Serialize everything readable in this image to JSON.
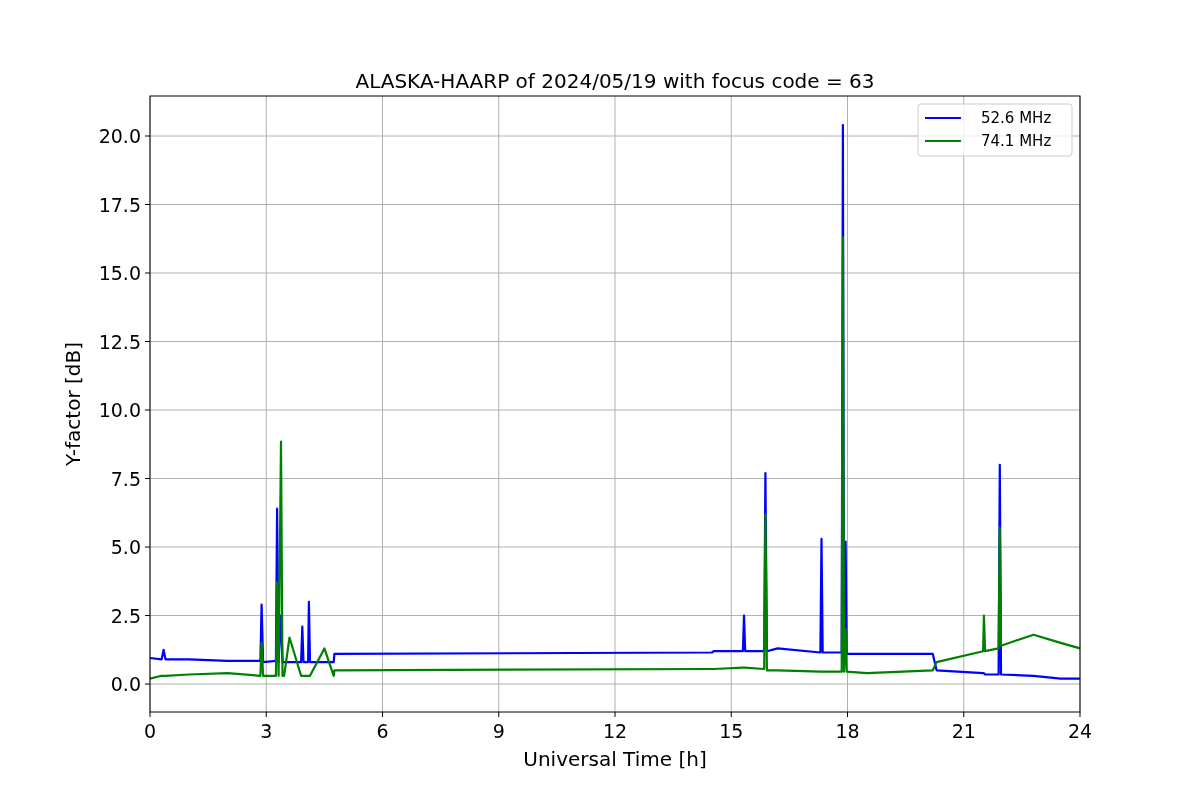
{
  "figure": {
    "chart_data": {
      "type": "line",
      "title": "ALASKA-HAARP of 2024/05/19 with focus code = 63",
      "xlabel": "Universal Time [h]",
      "ylabel": "Y-factor [dB]",
      "x": [
        0,
        0.3,
        0.35,
        0.4,
        1,
        2,
        2.85,
        2.88,
        2.92,
        3.25,
        3.28,
        3.32,
        3.38,
        3.42,
        3.46,
        3.6,
        3.9,
        3.93,
        3.96,
        4.08,
        4.1,
        4.13,
        4.5,
        4.74,
        4.76,
        14.5,
        14.55,
        15.3,
        15.33,
        15.36,
        15.85,
        15.88,
        15.92,
        16.2,
        17.3,
        17.33,
        17.36,
        17.85,
        17.88,
        17.91,
        17.95,
        17.98,
        18.5,
        20.2,
        20.3,
        21.5,
        21.52,
        21.55,
        21.9,
        21.93,
        21.96,
        22.8,
        23.5,
        24
      ],
      "series": [
        {
          "name": "52.6 MHz",
          "color": "#0000ff",
          "values": [
            0.95,
            0.9,
            1.25,
            0.9,
            0.9,
            0.85,
            0.85,
            2.9,
            0.8,
            0.85,
            6.4,
            0.8,
            2.5,
            0.8,
            0.8,
            0.8,
            0.8,
            2.1,
            0.8,
            0.8,
            3.0,
            0.8,
            0.8,
            0.8,
            1.1,
            1.15,
            1.2,
            1.2,
            2.5,
            1.2,
            1.2,
            7.7,
            1.2,
            1.3,
            1.15,
            5.3,
            1.15,
            1.15,
            20.4,
            1.1,
            5.2,
            1.1,
            1.1,
            1.1,
            0.5,
            0.4,
            0.4,
            0.35,
            0.35,
            8.0,
            0.35,
            0.3,
            0.2,
            0.2
          ]
        },
        {
          "name": "74.1 MHz",
          "color": "#008000",
          "values": [
            0.2,
            0.3,
            0.3,
            0.3,
            0.35,
            0.4,
            0.3,
            1.5,
            0.3,
            0.3,
            3.7,
            0.3,
            8.85,
            0.3,
            0.3,
            1.7,
            0.3,
            0.3,
            0.3,
            0.3,
            0.3,
            0.3,
            1.3,
            0.3,
            0.5,
            0.55,
            0.55,
            0.6,
            0.6,
            0.6,
            0.55,
            6.2,
            0.5,
            0.5,
            0.45,
            0.45,
            0.45,
            0.45,
            16.3,
            0.45,
            2.0,
            0.45,
            0.4,
            0.5,
            0.8,
            1.2,
            2.5,
            1.2,
            1.3,
            5.7,
            1.4,
            1.8,
            1.5,
            1.3
          ]
        }
      ],
      "grid": true,
      "legend": "upper right",
      "xlim": [
        0,
        24
      ],
      "ylim": [
        -1.02,
        21.46
      ],
      "xticks": [
        0,
        3,
        6,
        9,
        12,
        15,
        18,
        21,
        24
      ],
      "yticks": [
        {
          "value": 0,
          "label": "0.0"
        },
        {
          "value": 2.5,
          "label": "2.5"
        },
        {
          "value": 5,
          "label": "5.0"
        },
        {
          "value": 7.5,
          "label": "7.5"
        },
        {
          "value": 10,
          "label": "10.0"
        },
        {
          "value": 12.5,
          "label": "12.5"
        },
        {
          "value": 15,
          "label": "15.0"
        },
        {
          "value": 17.5,
          "label": "17.5"
        },
        {
          "value": 20,
          "label": "20.0"
        }
      ]
    }
  }
}
